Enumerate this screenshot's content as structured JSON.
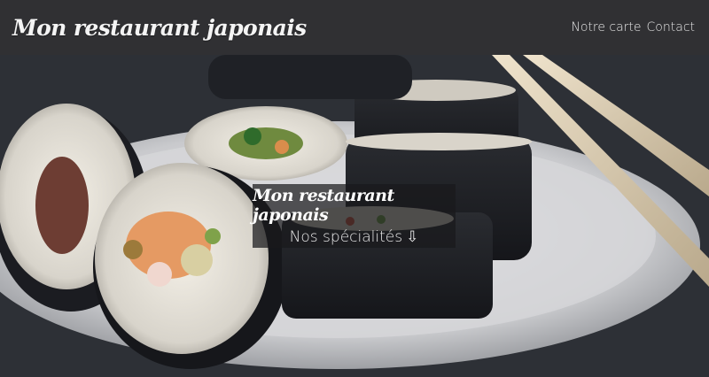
{
  "navbar": {
    "brand": "Mon restaurant japonais",
    "links": [
      {
        "label": "Notre carte"
      },
      {
        "label": "Contact"
      }
    ]
  },
  "hero": {
    "image_subject": "sushi rolls on a white plate with chopsticks",
    "title": "Mon restaurant japonais",
    "cta_label": "Nos spécialités",
    "cta_icon": "down-arrow-icon"
  }
}
